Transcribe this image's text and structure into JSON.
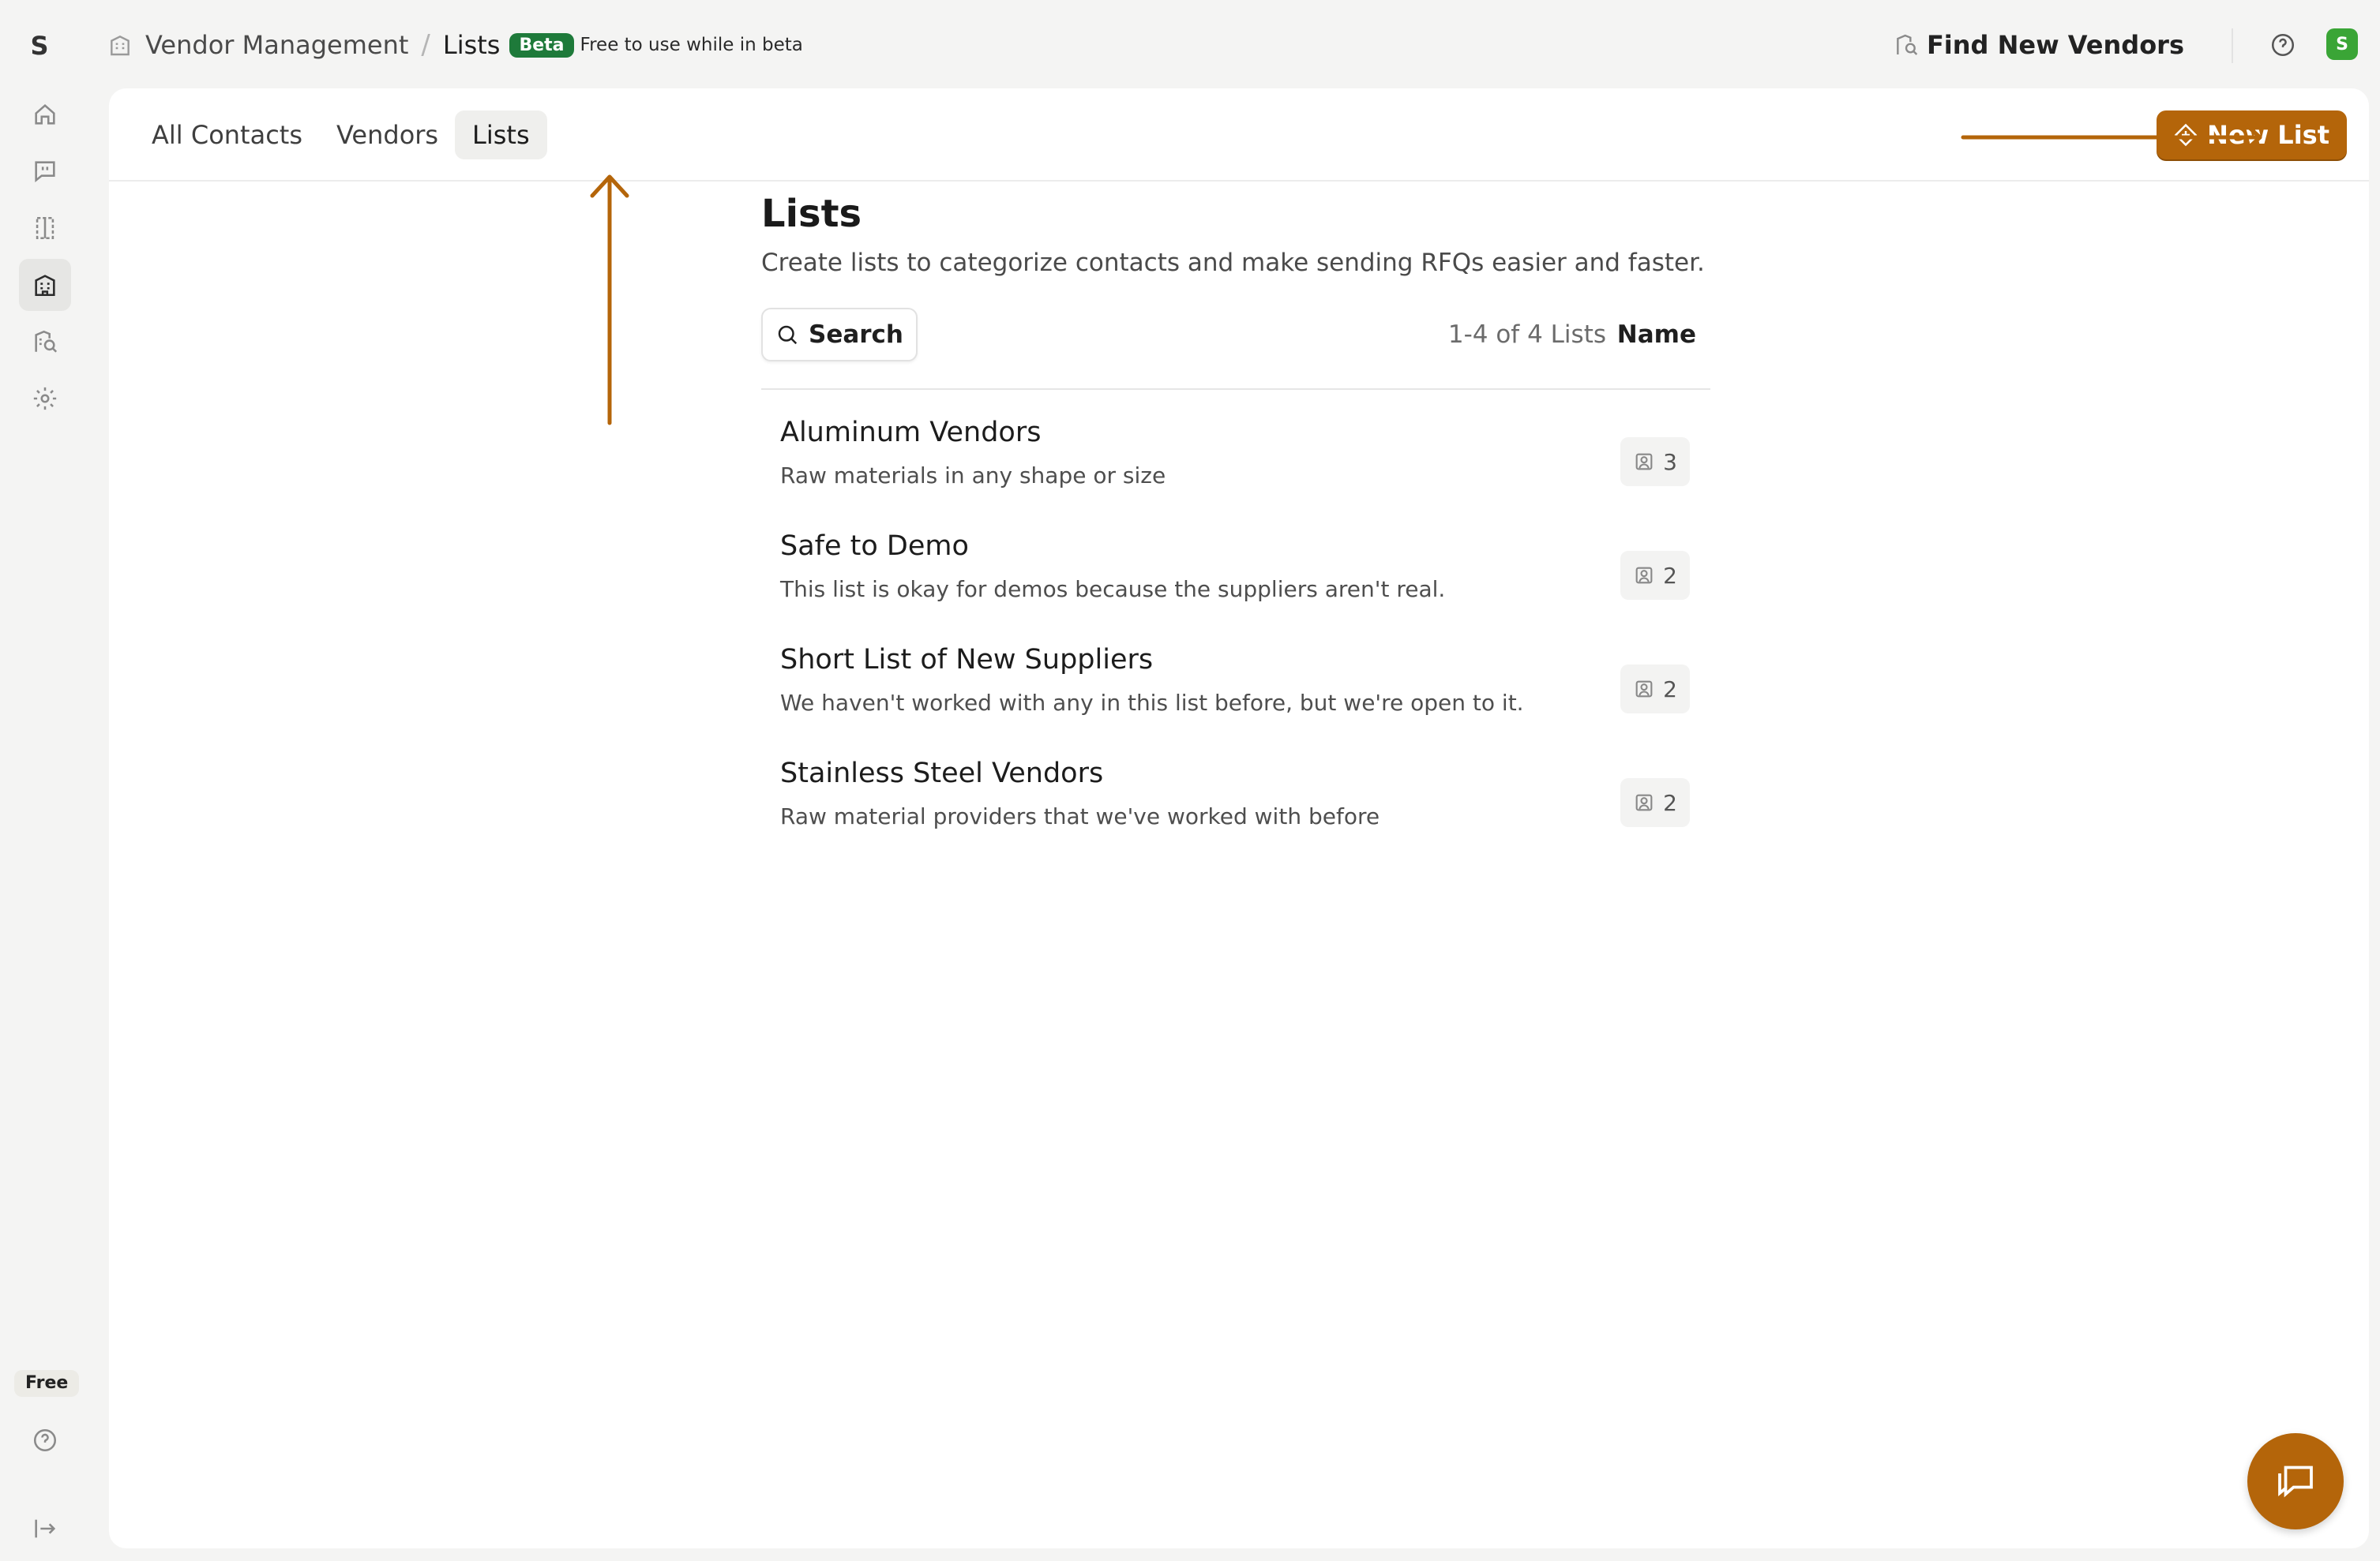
{
  "app": {
    "logo_letter": "S",
    "user_initial": "S"
  },
  "sidebar": {
    "items": [
      {
        "name": "home",
        "icon": "home-icon"
      },
      {
        "name": "messages",
        "icon": "message-quote-icon"
      },
      {
        "name": "quotes",
        "icon": "split-document-icon"
      },
      {
        "name": "vendor-management",
        "icon": "building-icon",
        "active": true
      },
      {
        "name": "find-vendors",
        "icon": "building-search-icon"
      },
      {
        "name": "settings",
        "icon": "gear-icon"
      }
    ],
    "plan_badge": "Free",
    "help_icon": "help-circle-icon",
    "logout_icon": "logout-icon"
  },
  "header": {
    "breadcrumb_root": "Vendor Management",
    "breadcrumb_sep": "/",
    "breadcrumb_current": "Lists",
    "beta_badge": "Beta",
    "beta_note": "Free to use while in beta",
    "find_vendors_label": "Find New Vendors"
  },
  "tabs": [
    {
      "label": "All Contacts"
    },
    {
      "label": "Vendors"
    },
    {
      "label": "Lists",
      "active": true
    }
  ],
  "new_list_button": "New List",
  "page": {
    "title": "Lists",
    "subtitle": "Create lists to categorize contacts and make sending RFQs easier and faster.",
    "search_label": "Search",
    "count_text": "1-4 of 4 Lists",
    "sort_label": "Name"
  },
  "lists": [
    {
      "name": "Aluminum Vendors",
      "description": "Raw materials in any shape or size",
      "count": "3"
    },
    {
      "name": "Safe to Demo",
      "description": "This list is okay for demos because the suppliers aren't real.",
      "count": "2"
    },
    {
      "name": "Short List of New Suppliers",
      "description": "We haven't worked with any in this list before, but we're open to it.",
      "count": "2"
    },
    {
      "name": "Stainless Steel Vendors",
      "description": "Raw material providers that we've worked with before",
      "count": "2"
    }
  ],
  "colors": {
    "accent": "#b4650a",
    "beta": "#1e7a3a",
    "avatar": "#3aa536"
  }
}
